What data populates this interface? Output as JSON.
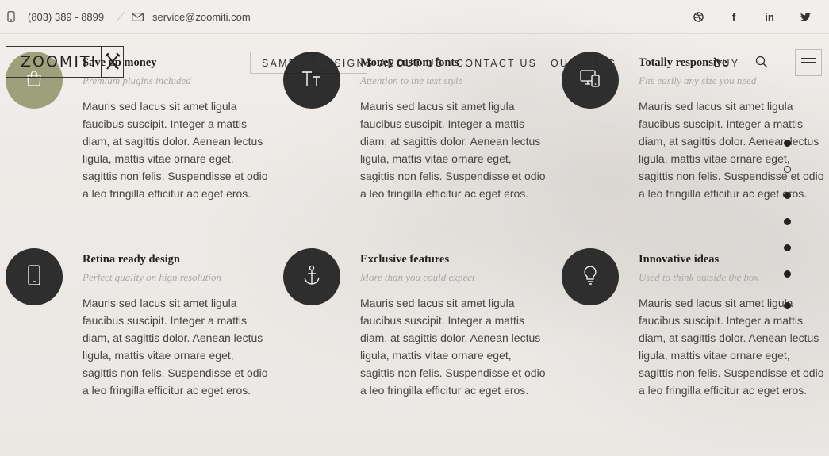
{
  "topbar": {
    "phone": "(803) 389 - 8899",
    "email": "service@zoomiti.com",
    "social": [
      {
        "icon": "dribbble-icon",
        "glyph": "⊛"
      },
      {
        "icon": "facebook-icon",
        "glyph": "f"
      },
      {
        "icon": "linkedin-icon",
        "glyph": "in"
      },
      {
        "icon": "twitter-icon",
        "glyph": "🐦"
      }
    ]
  },
  "header": {
    "logo_text": "ZOOMITI",
    "nav": [
      "SAMPLE DESIGNS",
      "ABOUT US",
      "CONTACT US",
      "OUR BLOG",
      "BUY"
    ]
  },
  "features": [
    {
      "icon": "shopping-bag-icon",
      "title": "Save up money",
      "subtitle": "Premium plugins included",
      "text": "Mauris sed lacus sit amet ligula faucibus suscipit. Integer a mattis diam, at sagittis dolor. Aenean lectus ligula, mattis vitae ornare eget, sagittis non felis. Suspendisse et odio a leo fringilla efficitur ac eget eros."
    },
    {
      "icon": "typography-icon",
      "title": "Money custom fonts",
      "subtitle": "Attention to the text style",
      "text": "Mauris sed lacus sit amet ligula faucibus suscipit. Integer a mattis diam, at sagittis dolor. Aenean lectus ligula, mattis vitae ornare eget, sagittis non felis. Suspendisse et odio a leo fringilla efficitur ac eget eros."
    },
    {
      "icon": "responsive-devices-icon",
      "title": "Totally responsive",
      "subtitle": "Fits easily any size you need",
      "text": "Mauris sed lacus sit amet ligula faucibus suscipit. Integer a mattis diam, at sagittis dolor. Aenean lectus ligula, mattis vitae ornare eget, sagittis non felis. Suspendisse et odio a leo fringilla efficitur ac eget eros."
    },
    {
      "icon": "mobile-phone-icon",
      "title": "Retina ready design",
      "subtitle": "Perfect quality on hign resolution",
      "text": "Mauris sed lacus sit amet ligula faucibus suscipit. Integer a mattis diam, at sagittis dolor. Aenean lectus ligula, mattis vitae ornare eget, sagittis non felis. Suspendisse et odio a leo fringilla efficitur ac eget eros."
    },
    {
      "icon": "anchor-icon",
      "title": "Exclusive features",
      "subtitle": "More than you could expect",
      "text": "Mauris sed lacus sit amet ligula faucibus suscipit. Integer a mattis diam, at sagittis dolor. Aenean lectus ligula, mattis vitae ornare eget, sagittis non felis. Suspendisse et odio a leo fringilla efficitur ac eget eros."
    },
    {
      "icon": "lightbulb-icon",
      "title": "Innovative ideas",
      "subtitle": "Used to think outside the box",
      "text": "Mauris sed lacus sit amet ligula faucibus suscipit. Integer a mattis diam, at sagittis dolor. Aenean lectus ligula, mattis vitae ornare eget, sagittis non felis. Suspendisse et odio a leo fringilla efficitur ac eget eros."
    }
  ],
  "colors": {
    "accent": "#9da07a",
    "icon_circle": "#2e2e2e"
  }
}
